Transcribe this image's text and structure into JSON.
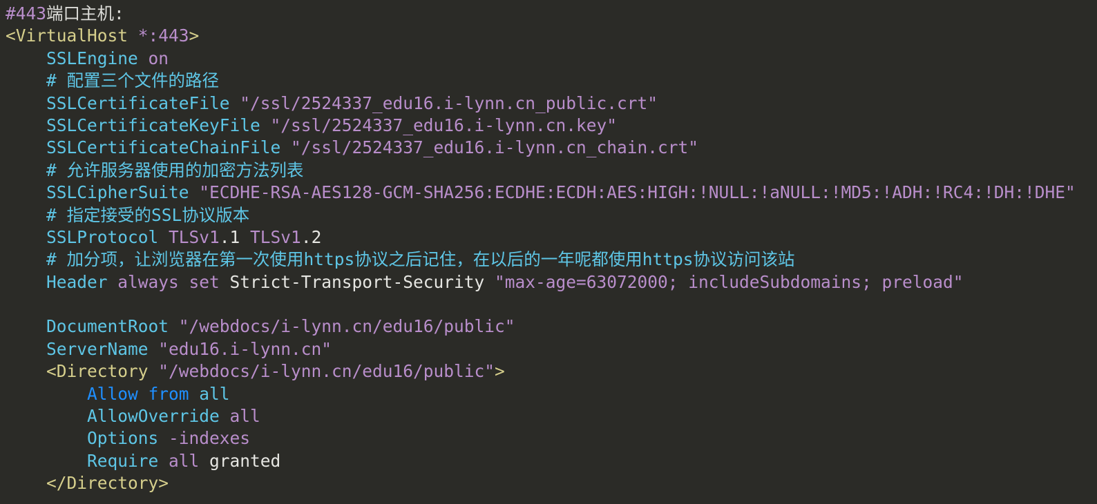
{
  "editor": {
    "lines": [
      [
        [
          "#443",
          "t-num"
        ],
        [
          "端口主机:",
          "t-text"
        ]
      ],
      [
        [
          "<VirtualHost ",
          "t-tag"
        ],
        [
          "*:443",
          "t-num"
        ],
        [
          ">",
          "t-tag"
        ]
      ],
      [
        [
          "    SSLEngine ",
          "t-key"
        ],
        [
          "on",
          "t-val"
        ]
      ],
      [
        [
          "    # 配置三个文件的路径",
          "t-comment"
        ]
      ],
      [
        [
          "    SSLCertificateFile ",
          "t-key"
        ],
        [
          "\"/ssl/2524337_edu16.i-lynn.cn_public.crt\"",
          "t-str"
        ]
      ],
      [
        [
          "    SSLCertificateKeyFile ",
          "t-key"
        ],
        [
          "\"/ssl/2524337_edu16.i-lynn.cn.key\"",
          "t-str"
        ]
      ],
      [
        [
          "    SSLCertificateChainFile ",
          "t-key"
        ],
        [
          "\"/ssl/2524337_edu16.i-lynn.cn_chain.crt\"",
          "t-str"
        ]
      ],
      [
        [
          "    # 允许服务器使用的加密方法列表",
          "t-comment"
        ]
      ],
      [
        [
          "    SSLCipherSuite ",
          "t-key"
        ],
        [
          "\"ECDHE-RSA-AES128-GCM-SHA256:ECDHE:ECDH:AES:HIGH:!NULL:!aNULL:!MD5:!ADH:!RC4:!DH:!DHE\"",
          "t-str"
        ]
      ],
      [
        [
          "    # 指定接受的SSL协议版本",
          "t-comment"
        ]
      ],
      [
        [
          "    SSLProtocol ",
          "t-key"
        ],
        [
          "TLSv1",
          "t-val"
        ],
        [
          ".1 ",
          "t-plain"
        ],
        [
          "TLSv1",
          "t-val"
        ],
        [
          ".2",
          "t-plain"
        ]
      ],
      [
        [
          "    # 加分项，让浏览器在第一次使用https协议之后记住，在以后的一年呢都使用https协议访问该站",
          "t-comment"
        ]
      ],
      [
        [
          "    Header ",
          "t-key"
        ],
        [
          "always set ",
          "t-val"
        ],
        [
          "Strict-Transport-Security ",
          "t-plain"
        ],
        [
          "\"max-age=63072000; includeSubdomains; preload\"",
          "t-str"
        ]
      ],
      [
        [
          "",
          "t-plain"
        ]
      ],
      [
        [
          "    DocumentRoot ",
          "t-key"
        ],
        [
          "\"/webdocs/i-lynn.cn/edu16/public\"",
          "t-str"
        ]
      ],
      [
        [
          "    ServerName ",
          "t-key"
        ],
        [
          "\"edu16.i-lynn.cn\"",
          "t-str"
        ]
      ],
      [
        [
          "    <Directory ",
          "t-tag"
        ],
        [
          "\"/webdocs/i-lynn.cn/edu16/public\"",
          "t-str"
        ],
        [
          ">",
          "t-tag"
        ]
      ],
      [
        [
          "        Allow from ",
          "t-kw"
        ],
        [
          "all",
          "t-key"
        ]
      ],
      [
        [
          "        AllowOverride ",
          "t-key"
        ],
        [
          "all",
          "t-val"
        ]
      ],
      [
        [
          "        Options ",
          "t-key"
        ],
        [
          "-indexes",
          "t-val"
        ]
      ],
      [
        [
          "        Require ",
          "t-key"
        ],
        [
          "all ",
          "t-val"
        ],
        [
          "granted",
          "t-plain"
        ]
      ],
      [
        [
          "    </Directory>",
          "t-tag"
        ]
      ]
    ]
  }
}
